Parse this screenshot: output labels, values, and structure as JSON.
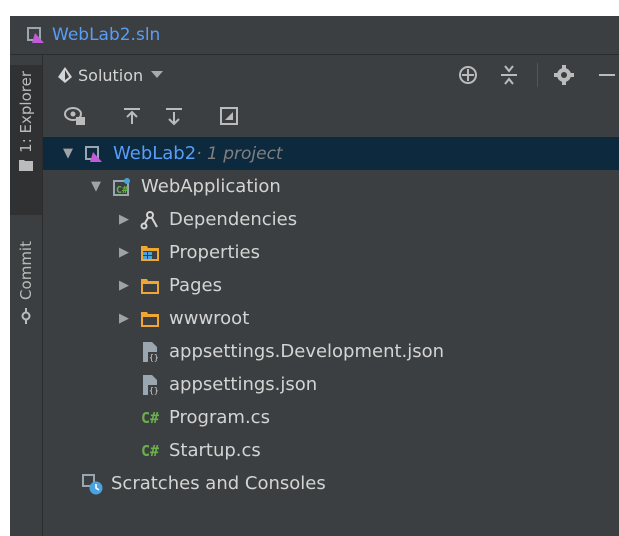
{
  "window": {
    "title": "WebLab2.sln"
  },
  "side_tabs": [
    {
      "label": "1: Explorer"
    },
    {
      "label": "Commit"
    }
  ],
  "header": {
    "view_label": "Solution"
  },
  "tree": {
    "root": {
      "label": "WebLab2",
      "hint": " · 1 project"
    },
    "project": {
      "label": "WebApplication"
    },
    "items": [
      {
        "label": "Dependencies"
      },
      {
        "label": "Properties"
      },
      {
        "label": "Pages"
      },
      {
        "label": "wwwroot"
      },
      {
        "label": "appsettings.Development.json"
      },
      {
        "label": "appsettings.json"
      },
      {
        "label": "Program.cs",
        "badge": "C#"
      },
      {
        "label": "Startup.cs",
        "badge": "C#"
      }
    ],
    "scratches": {
      "label": "Scratches and Consoles"
    }
  },
  "colors": {
    "panel_bg": "#3c3f41",
    "selection": "#0d293e",
    "link_blue": "#589df6",
    "folder_orange": "#f0a732",
    "csharp_green": "#6ab04c"
  }
}
